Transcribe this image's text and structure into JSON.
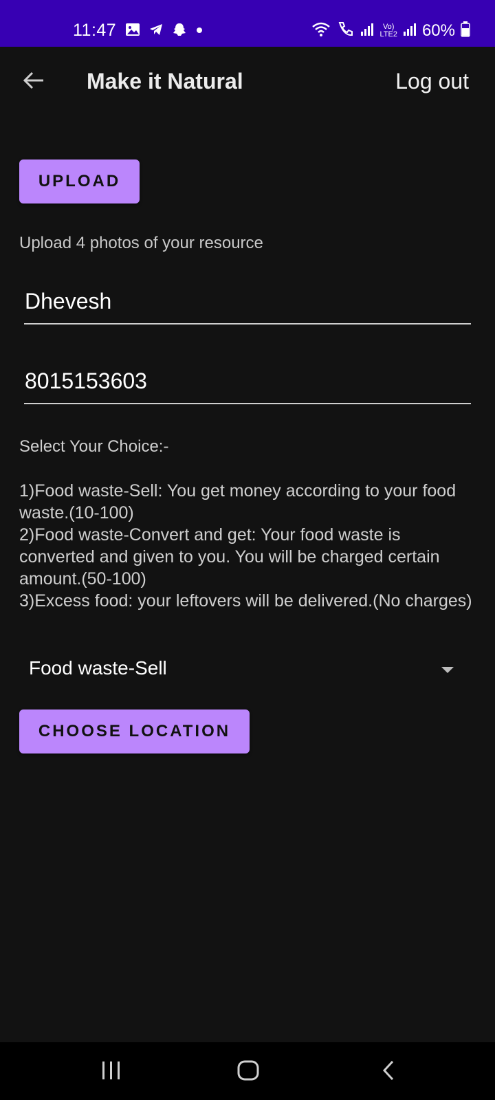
{
  "status_bar": {
    "time": "11:47",
    "left_icons": [
      "gallery-icon",
      "telegram-icon",
      "snapchat-icon",
      "notification-dot-icon"
    ],
    "right_icons": [
      "wifi-icon",
      "call-icon",
      "signal-icon",
      "volte-lte2-icon",
      "signal-icon"
    ],
    "volte_label": "Vo)",
    "lte_label": "LTE2",
    "battery": "60%"
  },
  "toolbar": {
    "title": "Make it Natural",
    "logout_label": "Log out"
  },
  "upload_button": "UPLOAD",
  "upload_hint": "Upload 4 photos of your resource",
  "name_field": {
    "value": "Dhevesh"
  },
  "phone_field": {
    "value": "8015153603"
  },
  "choice_title": "Select Your Choice:-",
  "choices": [
    " 1)Food waste-Sell: You get money according to your food waste.(10-100)",
    " 2)Food waste-Convert and get: Your food waste is converted and given to you. You will be charged certain amount.(50-100)",
    " 3)Excess food: your leftovers will be delivered.(No charges)"
  ],
  "spinner": {
    "selected": "Food waste-Sell"
  },
  "location_button": "CHOOSE LOCATION",
  "colors": {
    "status_bar": "#3700b3",
    "background": "#121212",
    "accent": "#bb86fc"
  },
  "nav_icons": [
    "recents-icon",
    "home-icon",
    "back-icon"
  ]
}
